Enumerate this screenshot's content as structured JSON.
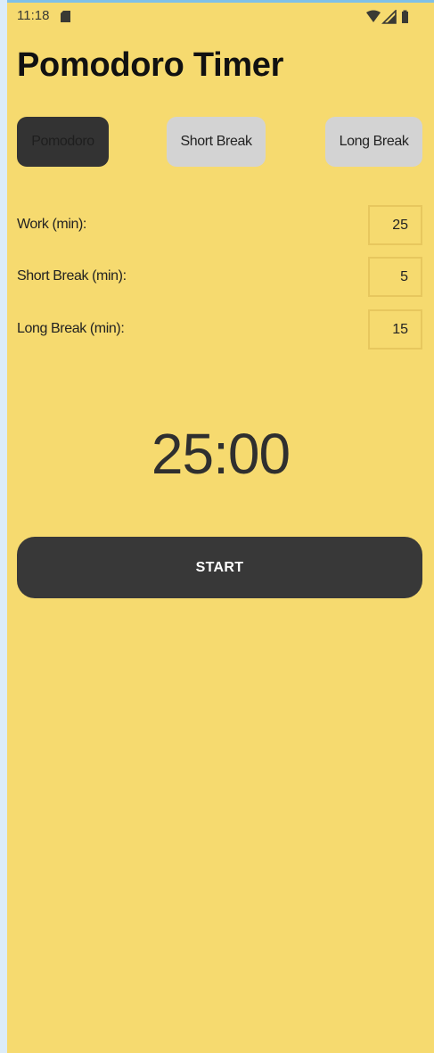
{
  "status_bar": {
    "time": "11:18",
    "icons": [
      "sim-card-icon",
      "wifi-icon",
      "signal-icon",
      "battery-icon"
    ]
  },
  "app": {
    "title": "Pomodoro Timer"
  },
  "modes": {
    "pomodoro": "Pomodoro",
    "short_break": "Short Break",
    "long_break": "Long Break",
    "active": "Pomodoro"
  },
  "settings": {
    "work_label": "Work (min):",
    "work_value": "25",
    "short_break_label": "Short Break (min):",
    "short_break_value": "5",
    "long_break_label": "Long Break (min):",
    "long_break_value": "15"
  },
  "timer": {
    "display": "25:00"
  },
  "controls": {
    "start_label": "START"
  },
  "colors": {
    "background": "#f6da6f",
    "active_button": "#333333",
    "inactive_button": "#d3d3d3",
    "start_button": "#383838",
    "input_border": "#e7c75e",
    "page_margin": "#dcecf8"
  }
}
